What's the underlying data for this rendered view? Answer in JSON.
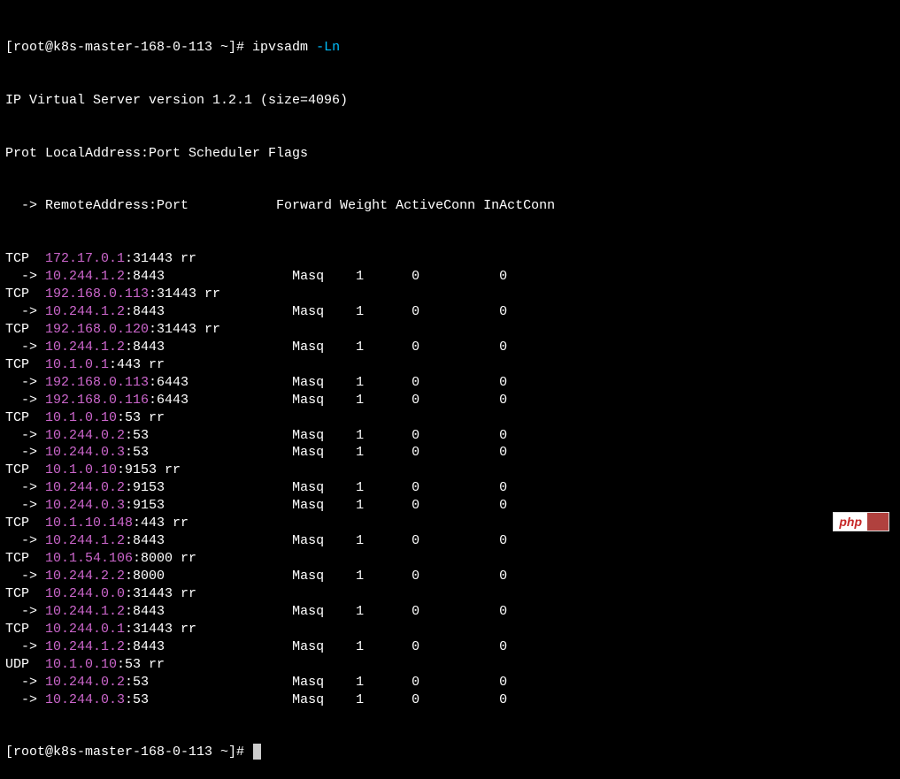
{
  "prompt1": {
    "prefix": "[root@k8s-master-168-0-113 ~]# ",
    "command": "ipvsadm ",
    "arg": "-Ln"
  },
  "version_line": "IP Virtual Server version 1.2.1 (size=4096)",
  "header1": "Prot LocalAddress:Port Scheduler Flags",
  "header2": "  -> RemoteAddress:Port           Forward Weight ActiveConn InActConn",
  "rows": [
    {
      "type": "svc",
      "proto": "TCP  ",
      "ip": "172.17.0.1",
      "rest": ":31443 rr"
    },
    {
      "type": "bak",
      "arrow": "  -> ",
      "ip": "10.244.1.2",
      "port": ":8443",
      "fwd": "Masq",
      "w": "1",
      "ac": "0",
      "iac": "0"
    },
    {
      "type": "svc",
      "proto": "TCP  ",
      "ip": "192.168.0.113",
      "rest": ":31443 rr"
    },
    {
      "type": "bak",
      "arrow": "  -> ",
      "ip": "10.244.1.2",
      "port": ":8443",
      "fwd": "Masq",
      "w": "1",
      "ac": "0",
      "iac": "0"
    },
    {
      "type": "svc",
      "proto": "TCP  ",
      "ip": "192.168.0.120",
      "rest": ":31443 rr"
    },
    {
      "type": "bak",
      "arrow": "  -> ",
      "ip": "10.244.1.2",
      "port": ":8443",
      "fwd": "Masq",
      "w": "1",
      "ac": "0",
      "iac": "0"
    },
    {
      "type": "svc",
      "proto": "TCP  ",
      "ip": "10.1.0.1",
      "rest": ":443 rr"
    },
    {
      "type": "bak",
      "arrow": "  -> ",
      "ip": "192.168.0.113",
      "port": ":6443",
      "fwd": "Masq",
      "w": "1",
      "ac": "0",
      "iac": "0"
    },
    {
      "type": "bak",
      "arrow": "  -> ",
      "ip": "192.168.0.116",
      "port": ":6443",
      "fwd": "Masq",
      "w": "1",
      "ac": "0",
      "iac": "0"
    },
    {
      "type": "svc",
      "proto": "TCP  ",
      "ip": "10.1.0.10",
      "rest": ":53 rr"
    },
    {
      "type": "bak",
      "arrow": "  -> ",
      "ip": "10.244.0.2",
      "port": ":53",
      "fwd": "Masq",
      "w": "1",
      "ac": "0",
      "iac": "0"
    },
    {
      "type": "bak",
      "arrow": "  -> ",
      "ip": "10.244.0.3",
      "port": ":53",
      "fwd": "Masq",
      "w": "1",
      "ac": "0",
      "iac": "0"
    },
    {
      "type": "svc",
      "proto": "TCP  ",
      "ip": "10.1.0.10",
      "rest": ":9153 rr"
    },
    {
      "type": "bak",
      "arrow": "  -> ",
      "ip": "10.244.0.2",
      "port": ":9153",
      "fwd": "Masq",
      "w": "1",
      "ac": "0",
      "iac": "0"
    },
    {
      "type": "bak",
      "arrow": "  -> ",
      "ip": "10.244.0.3",
      "port": ":9153",
      "fwd": "Masq",
      "w": "1",
      "ac": "0",
      "iac": "0"
    },
    {
      "type": "svc",
      "proto": "TCP  ",
      "ip": "10.1.10.148",
      "rest": ":443 rr"
    },
    {
      "type": "bak",
      "arrow": "  -> ",
      "ip": "10.244.1.2",
      "port": ":8443",
      "fwd": "Masq",
      "w": "1",
      "ac": "0",
      "iac": "0"
    },
    {
      "type": "svc",
      "proto": "TCP  ",
      "ip": "10.1.54.106",
      "rest": ":8000 rr"
    },
    {
      "type": "bak",
      "arrow": "  -> ",
      "ip": "10.244.2.2",
      "port": ":8000",
      "fwd": "Masq",
      "w": "1",
      "ac": "0",
      "iac": "0"
    },
    {
      "type": "svc",
      "proto": "TCP  ",
      "ip": "10.244.0.0",
      "rest": ":31443 rr"
    },
    {
      "type": "bak",
      "arrow": "  -> ",
      "ip": "10.244.1.2",
      "port": ":8443",
      "fwd": "Masq",
      "w": "1",
      "ac": "0",
      "iac": "0"
    },
    {
      "type": "svc",
      "proto": "TCP  ",
      "ip": "10.244.0.1",
      "rest": ":31443 rr"
    },
    {
      "type": "bak",
      "arrow": "  -> ",
      "ip": "10.244.1.2",
      "port": ":8443",
      "fwd": "Masq",
      "w": "1",
      "ac": "0",
      "iac": "0"
    },
    {
      "type": "svc",
      "proto": "UDP  ",
      "ip": "10.1.0.10",
      "rest": ":53 rr"
    },
    {
      "type": "bak",
      "arrow": "  -> ",
      "ip": "10.244.0.2",
      "port": ":53",
      "fwd": "Masq",
      "w": "1",
      "ac": "0",
      "iac": "0"
    },
    {
      "type": "bak",
      "arrow": "  -> ",
      "ip": "10.244.0.3",
      "port": ":53",
      "fwd": "Masq",
      "w": "1",
      "ac": "0",
      "iac": "0"
    }
  ],
  "prompt2": "[root@k8s-master-168-0-113 ~]# ",
  "badge": {
    "php": "php",
    "cn": ""
  }
}
